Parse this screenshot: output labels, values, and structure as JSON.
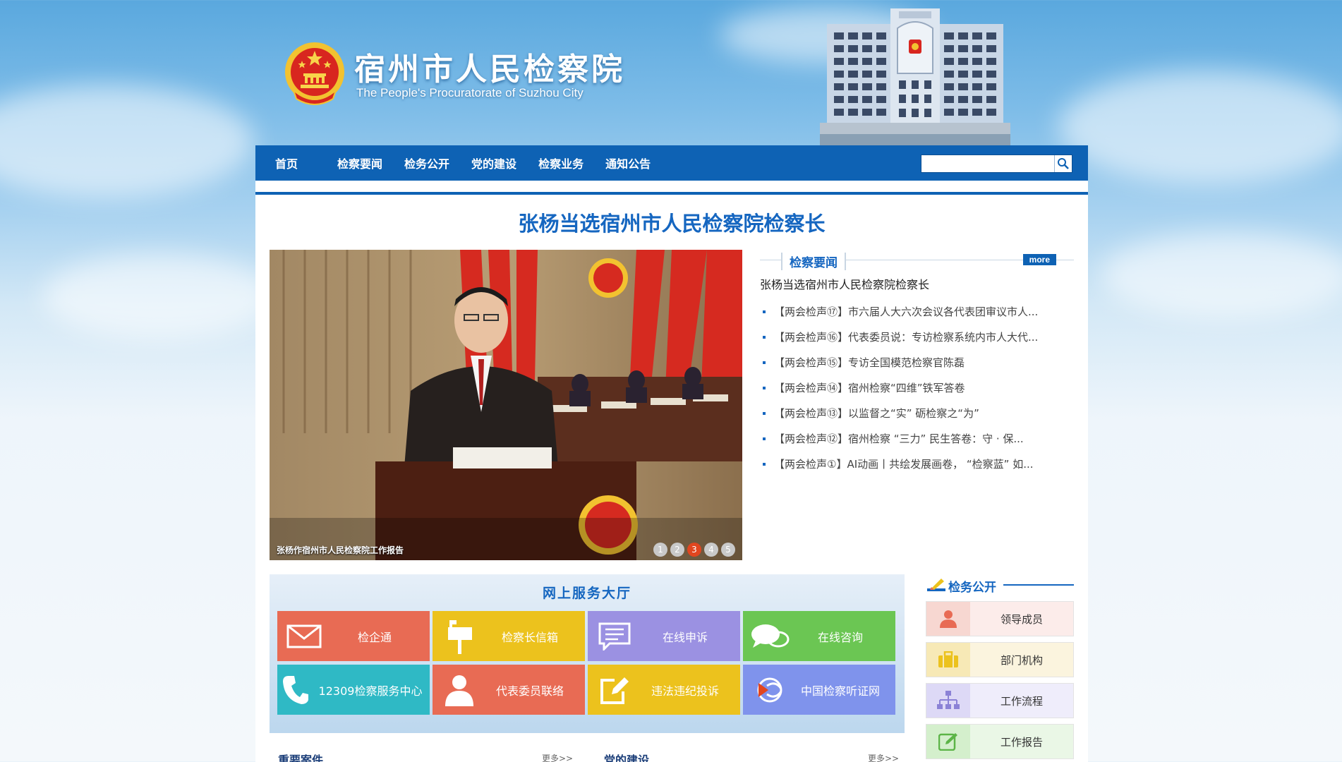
{
  "header": {
    "title": "宿州市人民检察院",
    "subtitle": "The People's Procuratorate of Suzhou City"
  },
  "nav": {
    "items": [
      "首页",
      "检察要闻",
      "检务公开",
      "党的建设",
      "检察业务",
      "通知公告"
    ],
    "search_placeholder": ""
  },
  "headline": "张杨当选宿州市人民检察院检察长",
  "slideshow": {
    "caption": "张杨作宿州市人民检察院工作报告",
    "pages": [
      "1",
      "2",
      "3",
      "4",
      "5"
    ],
    "active_page": 3
  },
  "news": {
    "title": "检察要闻",
    "more": "more",
    "top_item": "张杨当选宿州市人民检察院检察长",
    "items": [
      "【两会检声⑰】市六届人大六次会议各代表团审议市人...",
      "【两会检声⑯】代表委员说：专访检察系统内市人大代...",
      "【两会检声⑮】专访全国模范检察官陈磊",
      "【两会检声⑭】宿州检察“四维”铁军答卷",
      "【两会检声⑬】以监督之“实” 砺检察之“为”",
      "【两会检声⑫】宿州检察 “三力” 民生答卷：守 · 保...",
      "【两会检声①】AI动画丨共绘发展画卷， “检察蓝” 如..."
    ]
  },
  "service": {
    "title": "网上服务大厅",
    "tiles": [
      {
        "label": "检企通",
        "icon": "envelope-icon",
        "color": "#e86b54"
      },
      {
        "label": "检察长信箱",
        "icon": "mailbox-icon",
        "color": "#ecc21d"
      },
      {
        "label": "在线申诉",
        "icon": "document-chat-icon",
        "color": "#9b91e2"
      },
      {
        "label": "在线咨询",
        "icon": "chat-bubbles-icon",
        "color": "#6bc653"
      },
      {
        "label": "12309检察服务中心",
        "icon": "phone-icon",
        "color": "#2fb9c5"
      },
      {
        "label": "代表委员联络",
        "icon": "person-icon",
        "color": "#e86b54"
      },
      {
        "label": "违法违纪投诉",
        "icon": "edit-icon",
        "color": "#ecc21d"
      },
      {
        "label": "中国检察听证网",
        "icon": "hearing-logo-icon",
        "color": "#7f93ec"
      }
    ]
  },
  "sidebar": {
    "title": "检务公开",
    "items": [
      {
        "label": "领导成员",
        "icon": "person-icon",
        "color": "#e86b54"
      },
      {
        "label": "部门机构",
        "icon": "briefcase-icon",
        "color": "#ecc21d"
      },
      {
        "label": "工作流程",
        "icon": "org-chart-icon",
        "color": "#9b91e2"
      },
      {
        "label": "工作报告",
        "icon": "edit-icon",
        "color": "#6bc653"
      }
    ]
  },
  "bottom": {
    "left_title": "重要案件",
    "left_more": "更多>>",
    "right_title": "党的建设",
    "right_more": "更多>>"
  }
}
